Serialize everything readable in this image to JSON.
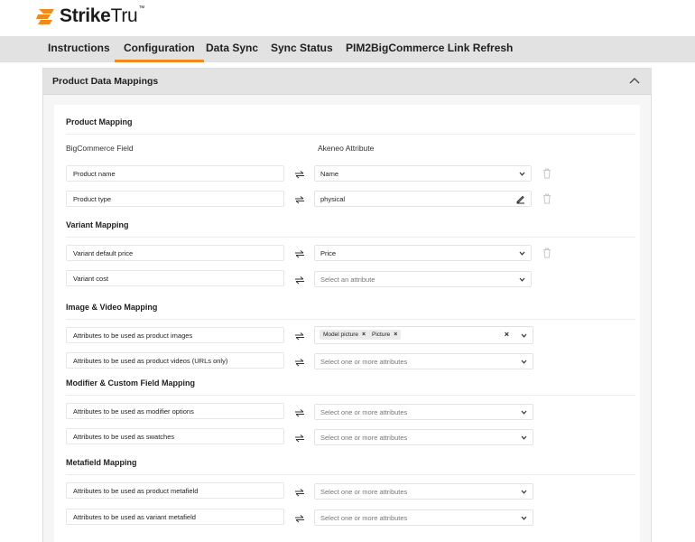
{
  "brand": {
    "name_bold": "Strike",
    "name_light": "Tru",
    "tm": "™",
    "accent": "#f08a1d"
  },
  "nav": {
    "tabs": [
      {
        "label": "Instructions"
      },
      {
        "label": "Configuration",
        "active": true
      },
      {
        "label": "Data Sync"
      },
      {
        "label": "Sync Status"
      },
      {
        "label": "PIM2BigCommerce Link Refresh"
      }
    ]
  },
  "panel": {
    "title": "Product Data Mappings",
    "expanded": true
  },
  "columns": {
    "left": "BigCommerce Field",
    "right": "Akeneo Attribute"
  },
  "sections": {
    "product": {
      "title": "Product Mapping",
      "rows": [
        {
          "field": "Product name",
          "value": "Name"
        },
        {
          "field": "Product type",
          "value": "physical"
        }
      ]
    },
    "variant": {
      "title": "Variant Mapping",
      "rows": [
        {
          "field": "Variant default price",
          "value": "Price"
        },
        {
          "field": "Variant cost",
          "placeholder": "Select an attribute"
        }
      ]
    },
    "image": {
      "title": "Image & Video Mapping",
      "rows": [
        {
          "field": "Attributes to be used as product images",
          "chips": [
            "Model picture",
            "Picture"
          ]
        },
        {
          "field": "Attributes to be used as product videos (URLs only)",
          "placeholder": "Select one or more attributes"
        }
      ]
    },
    "modifier": {
      "title": "Modifier & Custom Field Mapping",
      "rows": [
        {
          "field": "Attributes to be used as modifier options",
          "placeholder": "Select one or more attributes"
        },
        {
          "field": "Attributes to be used as swatches",
          "placeholder": "Select one or more attributes"
        }
      ]
    },
    "metafield": {
      "title": "Metafield Mapping",
      "rows": [
        {
          "field": "Attributes to be used as product metafield",
          "placeholder": "Select one or more attributes"
        },
        {
          "field": "Attributes to be used as variant metafield",
          "placeholder": "Select one or more attributes"
        }
      ]
    }
  },
  "icons": {
    "logo": "stroke-s-logo-icon",
    "swap": "swap-arrows-icon",
    "caret": "chevron-down-icon",
    "pencil": "pencil-icon",
    "trash": "trash-icon",
    "remove": "close-icon",
    "collapse": "chevron-up-icon"
  }
}
